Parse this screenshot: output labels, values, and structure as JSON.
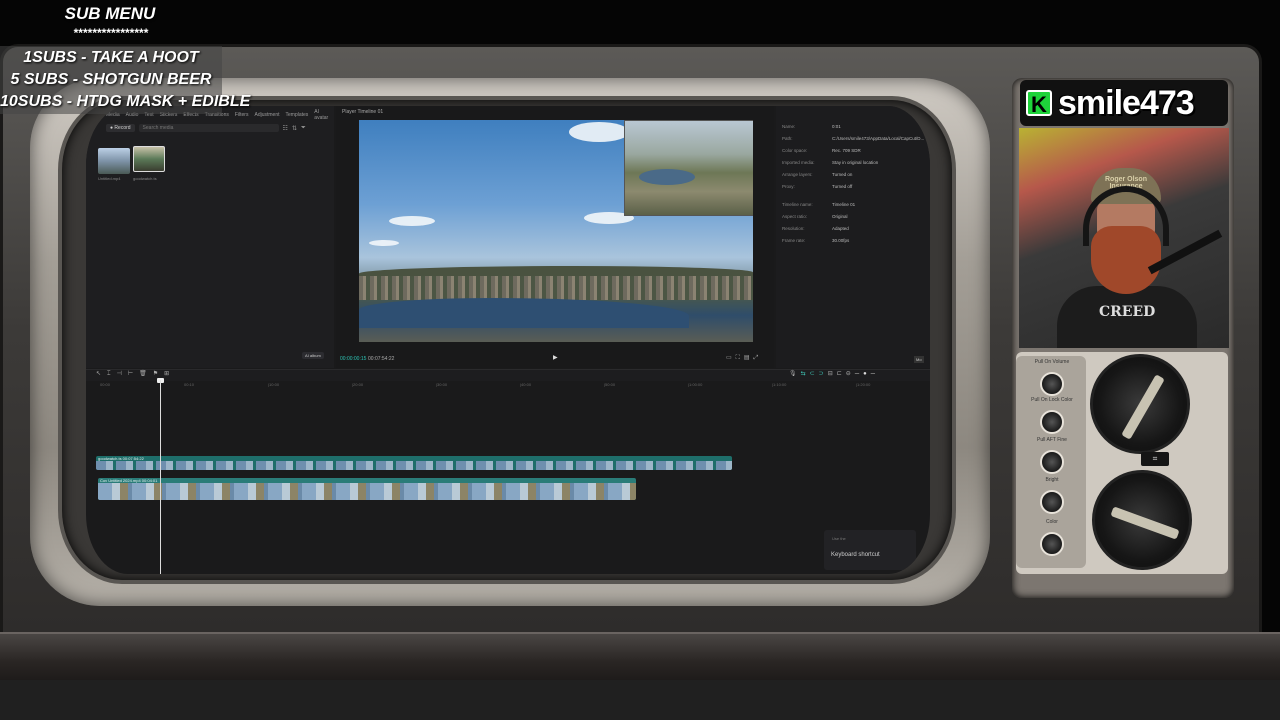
{
  "sub_menu": {
    "title": "SUB MENU",
    "stars": "****************",
    "tiers": [
      "1SUBS   - TAKE A HOOT",
      "5 SUBS  - SHOTGUN BEER",
      "10SUBS - HTDG MASK + EDIBLE"
    ]
  },
  "channel": {
    "platform_icon": "kick-logo-icon",
    "platform_glyph": "K",
    "username": "smile473"
  },
  "webcam": {
    "hat_text": "Roger Olson Insurance",
    "shirt_text": "CREED"
  },
  "tv_controls": {
    "knob_labels": [
      "Pull On Volume",
      "Pull On Lock Color",
      "Pull AFT Fine",
      "Bright",
      "Color"
    ],
    "channel_badge": "⌗"
  },
  "editor": {
    "top_tabs": [
      "Media",
      "Audio",
      "Text",
      "Stickers",
      "Effects",
      "Transitions",
      "Filters",
      "Adjustment",
      "Templates",
      "AI avatar"
    ],
    "record_label": "Record",
    "search_placeholder": "Search media",
    "media_items": [
      {
        "label": "Untitled.mp4"
      },
      {
        "label": "goodwatch.ts"
      }
    ],
    "ai_button": "AI  album",
    "player": {
      "title": "Player  Timeline 01",
      "current_time": "00:00:00:15",
      "total_time": "00:07:54:22"
    },
    "details": [
      {
        "key": "Name:",
        "value": "0:01"
      },
      {
        "key": "Path:",
        "value": "C:/Users/smile473/AppData/Local/CapCut/D..."
      },
      {
        "key": "Color space:",
        "value": "Rec. 709 SDR"
      },
      {
        "key": "Imported media:",
        "value": "Stay in original location"
      },
      {
        "key": "Arrange layers:",
        "value": "Turned on"
      },
      {
        "key": "Proxy:",
        "value": "Turned off"
      },
      {
        "key": "Timeline name:",
        "value": "Timeline 01"
      },
      {
        "key": "Aspect ratio:",
        "value": "Original"
      },
      {
        "key": "Resolution:",
        "value": "Adapted"
      },
      {
        "key": "Frame rate:",
        "value": "30.00fps"
      }
    ],
    "modify_label": "Mo",
    "ruler_ticks": [
      "00:00",
      "00:10",
      "|10:00",
      "|20:00",
      "|30:00",
      "|40:00",
      "|50:00",
      "|1:00:00",
      "|1:10:00",
      "|1:20:00"
    ],
    "tracks": [
      {
        "label": "goodwatch.ts   00:07:54:22"
      },
      {
        "label": "Cov  Untitled 2024.mp4   00:04:01"
      }
    ],
    "keyboard_small": "Use the",
    "keyboard_text": "Keyboard shortcut"
  },
  "colors": {
    "accent_teal": "#2cc2b2",
    "kick_green": "#1ed33a",
    "track_teal": "#1e6e6a"
  }
}
